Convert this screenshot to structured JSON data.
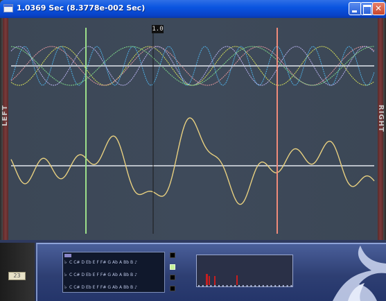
{
  "window": {
    "title": "1.0369 Sec (8.3778e-002 Sec)"
  },
  "scope": {
    "left_label": "LEFT",
    "right_label": "RIGHT",
    "center_marker_label": "1.0",
    "colors": {
      "background": "#3e4a5a",
      "baseline": "#b9bfc8",
      "left_cursor": "#9de08a",
      "right_cursor": "#f08b7a",
      "center_cursor": "#1a1a1a",
      "waveform": "#e8d080",
      "harmonic_yellow": "#d8e25a",
      "harmonic_pink": "#e59aa0",
      "harmonic_cyan": "#4fb0e6",
      "harmonic_lilac": "#b9b2ee",
      "harmonic_green": "#7fd88a"
    }
  },
  "panel": {
    "counter_value": "23",
    "note_names": [
      "C",
      "C#",
      "D",
      "Eb",
      "E",
      "F",
      "F#",
      "G",
      "Ab",
      "A",
      "Bb",
      "B"
    ],
    "note_rows": [
      {
        "clef": "♭",
        "end": "♪"
      },
      {
        "clef": "♭",
        "end": "♪"
      },
      {
        "clef": "♭",
        "end": "♪"
      }
    ],
    "spectrum_colors": {
      "bar": "#c81e1e",
      "background": "#2a3047"
    }
  }
}
